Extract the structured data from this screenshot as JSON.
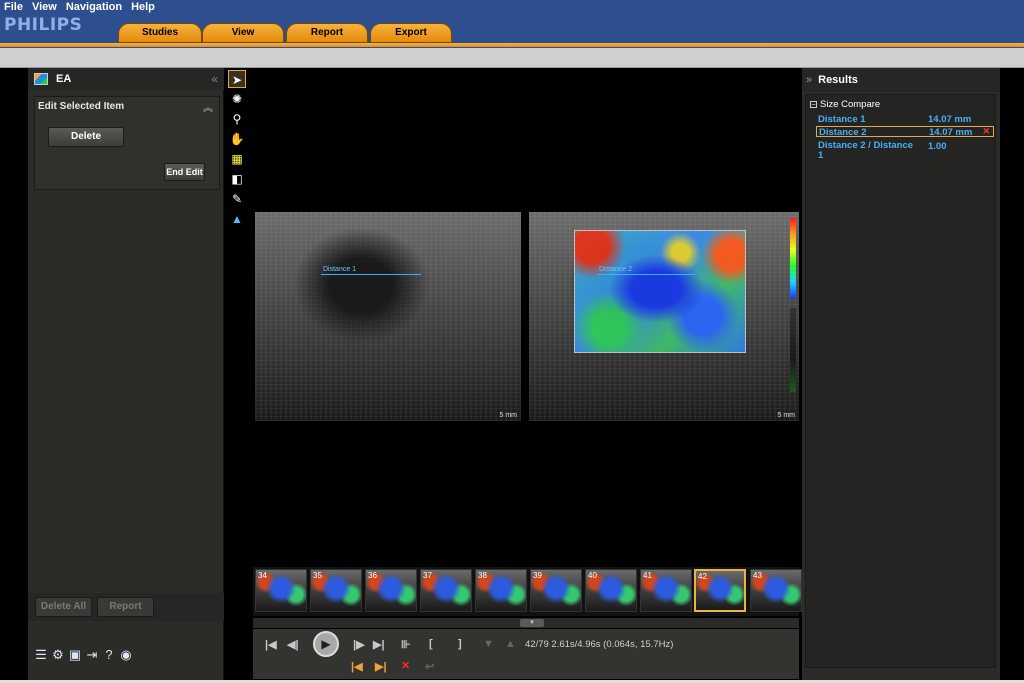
{
  "menu": [
    "File",
    "View",
    "Navigation",
    "Help"
  ],
  "brand": "PHILIPS",
  "tabs": [
    "Studies",
    "View",
    "Report",
    "Export"
  ],
  "left_panel": {
    "title": "EA",
    "edit_section_title": "Edit Selected Item",
    "delete_label": "Delete",
    "end_edit_label": "End Edit",
    "delete_all_label": "Delete All",
    "report_label": "Report"
  },
  "viewer": {
    "measure_left_label": "Distance 1",
    "measure_right_label": "Distance 2",
    "scale_left": "5 mm",
    "scale_right": "5 mm"
  },
  "thumbnails": [
    "34",
    "35",
    "36",
    "37",
    "38",
    "39",
    "40",
    "41",
    "42",
    "43"
  ],
  "selected_thumbnail": "42",
  "playback": {
    "frame_info": "42/79  2.61s/4.96s (0.064s, 15.7Hz)"
  },
  "results": {
    "title": "Results",
    "group": "Size Compare",
    "rows": [
      {
        "name": "Distance 1",
        "value": "14.07 mm"
      },
      {
        "name": "Distance 2",
        "value": "14.07 mm"
      },
      {
        "name": "Distance 2 / Distance 1",
        "value": "1.00"
      }
    ]
  },
  "colors": {
    "topbar": "#2d4e8f",
    "tab_orange": "#e38a0d",
    "measurement_blue": "#47b0f5",
    "selection_border": "#e6a84a"
  }
}
